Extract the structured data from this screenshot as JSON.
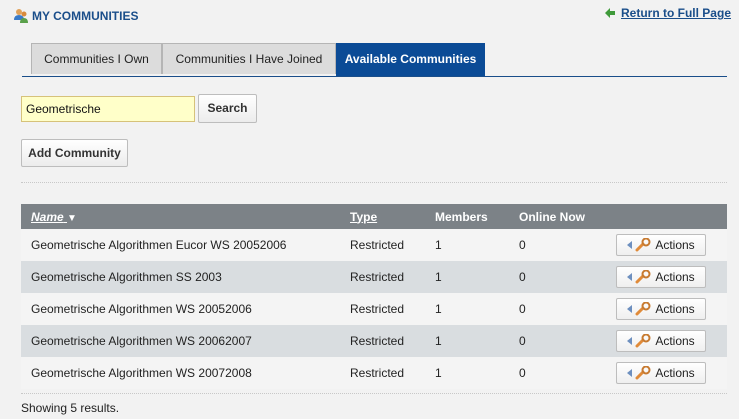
{
  "header": {
    "title": "MY COMMUNITIES",
    "return_link": "Return to Full Page"
  },
  "tabs": [
    {
      "label": "Communities I Own",
      "active": false
    },
    {
      "label": "Communities I Have Joined",
      "active": false
    },
    {
      "label": "Available Communities",
      "active": true
    }
  ],
  "search": {
    "value": "Geometrische",
    "button_label": "Search"
  },
  "add_button_label": "Add Community",
  "table": {
    "columns": {
      "name": "Name",
      "sort_indicator": "▼",
      "type": "Type",
      "members": "Members",
      "online": "Online Now"
    },
    "rows": [
      {
        "name": "Geometrische Algorithmen Eucor WS 20052006",
        "type": "Restricted",
        "members": "1",
        "online": "0",
        "action": "Actions"
      },
      {
        "name": "Geometrische Algorithmen SS 2003",
        "type": "Restricted",
        "members": "1",
        "online": "0",
        "action": "Actions"
      },
      {
        "name": "Geometrische Algorithmen WS 20052006",
        "type": "Restricted",
        "members": "1",
        "online": "0",
        "action": "Actions"
      },
      {
        "name": "Geometrische Algorithmen WS 20062007",
        "type": "Restricted",
        "members": "1",
        "online": "0",
        "action": "Actions"
      },
      {
        "name": "Geometrische Algorithmen WS 20072008",
        "type": "Restricted",
        "members": "1",
        "online": "0",
        "action": "Actions"
      }
    ]
  },
  "results_text": "Showing 5 results.",
  "colors": {
    "accent": "#0b4b96",
    "header_text": "#1a4e8a",
    "table_header": "#7c8287"
  },
  "icons": {
    "title": "communities-icon",
    "return": "return-arrow-icon",
    "actions": "wrench-icon"
  }
}
